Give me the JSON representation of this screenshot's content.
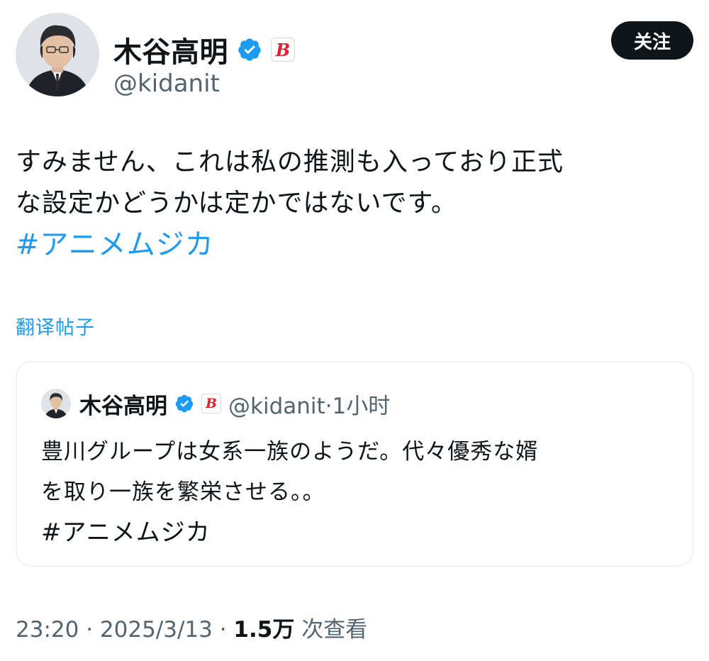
{
  "author": {
    "name": "木谷高明",
    "handle": "@kidanit",
    "badge_letter": "B"
  },
  "follow_button": {
    "label": "关注"
  },
  "tweet": {
    "lines": [
      "すみません、これは私の推測も入っており正式",
      "な設定かどうかは定かではないです。"
    ],
    "hashtag": "#アニメムジカ"
  },
  "translate_link": "翻译帖子",
  "quoted": {
    "name": "木谷高明",
    "handle": "@kidanit",
    "separator": "·",
    "time": "1小时",
    "lines": [
      "豊川グループは女系一族のようだ。代々優秀な婿",
      "を取り一族を繁栄させる。。"
    ],
    "hashtag": "#アニメムジカ"
  },
  "meta": {
    "time": "23:20",
    "sep1": " · ",
    "date": "2025/3/13",
    "sep2": " · ",
    "views_count": "1.5万",
    "views_label": " 次查看"
  },
  "colors": {
    "accent": "#1d9bf0",
    "text": "#0f1419",
    "secondary": "#536471",
    "badge_red": "#e0202f",
    "border": "#eff3f4"
  },
  "icons": {
    "verified": "verified-badge-icon",
    "affiliate": "b-affiliate-icon"
  }
}
